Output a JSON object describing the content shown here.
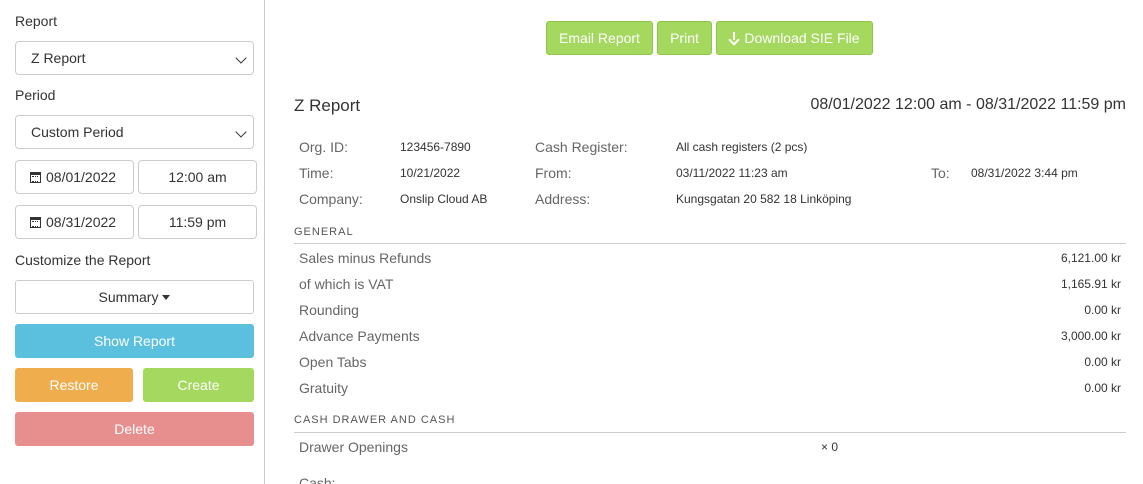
{
  "sidebar": {
    "report_label": "Report",
    "report_value": "Z Report",
    "period_label": "Period",
    "period_value": "Custom Period",
    "from_date": "08/01/2022",
    "from_time": "12:00 am",
    "to_date": "08/31/2022",
    "to_time": "11:59 pm",
    "customize_label": "Customize the Report",
    "summary_label": "Summary",
    "show_report": "Show Report",
    "restore": "Restore",
    "create": "Create",
    "delete": "Delete"
  },
  "toolbar": {
    "email": "Email Report",
    "print": "Print",
    "download": "Download SIE File"
  },
  "report": {
    "title": "Z Report",
    "range": "08/01/2022 12:00 am - 08/31/2022 11:59 pm",
    "meta": {
      "org_id_label": "Org. ID:",
      "org_id": "123456-7890",
      "time_label": "Time:",
      "time": "10/21/2022",
      "company_label": "Company:",
      "company": "Onslip Cloud AB",
      "register_label": "Cash Register:",
      "register": "All cash registers (2 pcs)",
      "from_label": "From:",
      "from": "03/11/2022 11:23 am",
      "address_label": "Address:",
      "address": "Kungsgatan 20 582 18 Linköping",
      "to_label": "To:",
      "to": "08/31/2022 3:44 pm"
    },
    "general_heading": "GENERAL",
    "general_rows": [
      {
        "label": "Sales minus Refunds",
        "value": "6,121.00 kr"
      },
      {
        "label": "of which is VAT",
        "value": "1,165.91 kr"
      },
      {
        "label": "Rounding",
        "value": "0.00 kr"
      },
      {
        "label": "Advance Payments",
        "value": "3,000.00 kr"
      },
      {
        "label": "Open Tabs",
        "value": "0.00 kr"
      },
      {
        "label": "Gratuity",
        "value": "0.00 kr"
      }
    ],
    "cash_heading": "CASH DRAWER AND CASH",
    "drawer_label": "Drawer Openings",
    "drawer_value": "× 0",
    "cash_label": "Cash:"
  }
}
